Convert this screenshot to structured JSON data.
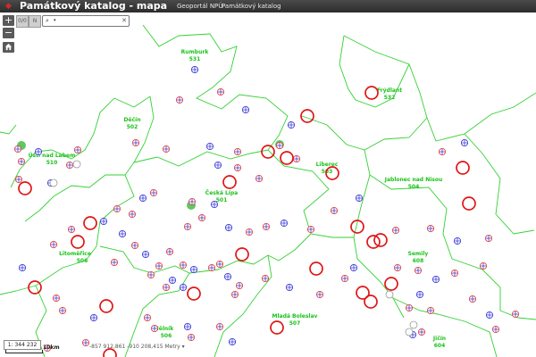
{
  "header": {
    "title": "Památkový katalog - mapa",
    "links": [
      "Geoportál NPÚ",
      "Památkový katalog"
    ]
  },
  "toolbar": {
    "zoom_in": "+",
    "zoom_out": "−",
    "home_icon": "home-icon",
    "tool_labels": [
      "0/0",
      "N"
    ],
    "search_value": "",
    "search_caret": "▾",
    "search_clear": "✕"
  },
  "districts": [
    {
      "name": "Rumburk",
      "code": "531"
    },
    {
      "name": "Frýdlant",
      "code": "532"
    },
    {
      "name": "Děčín",
      "code": "502"
    },
    {
      "name": "Ústí nad Labem",
      "code": "510"
    },
    {
      "name": "Liberec",
      "code": "503"
    },
    {
      "name": "Česká Lípa",
      "code": "501"
    },
    {
      "name": "Jablonec nad Nisou",
      "code": "504"
    },
    {
      "name": "Semily",
      "code": "608"
    },
    {
      "name": "Litoměřice",
      "code": "506"
    },
    {
      "name": "Mladá Boleslav",
      "code": "507"
    },
    {
      "name": "Mělník",
      "code": "506"
    },
    {
      "name": "Jičín",
      "code": "604"
    }
  ],
  "footer": {
    "scale": "1: 344 232",
    "scale_bar_label": "10km",
    "coordinates": "-857 912,861   -910 208,415 Metry  ▾"
  },
  "colors": {
    "boundary": "#19c219",
    "monument_circle": "#e01515",
    "monument_marker": "#e04040"
  }
}
